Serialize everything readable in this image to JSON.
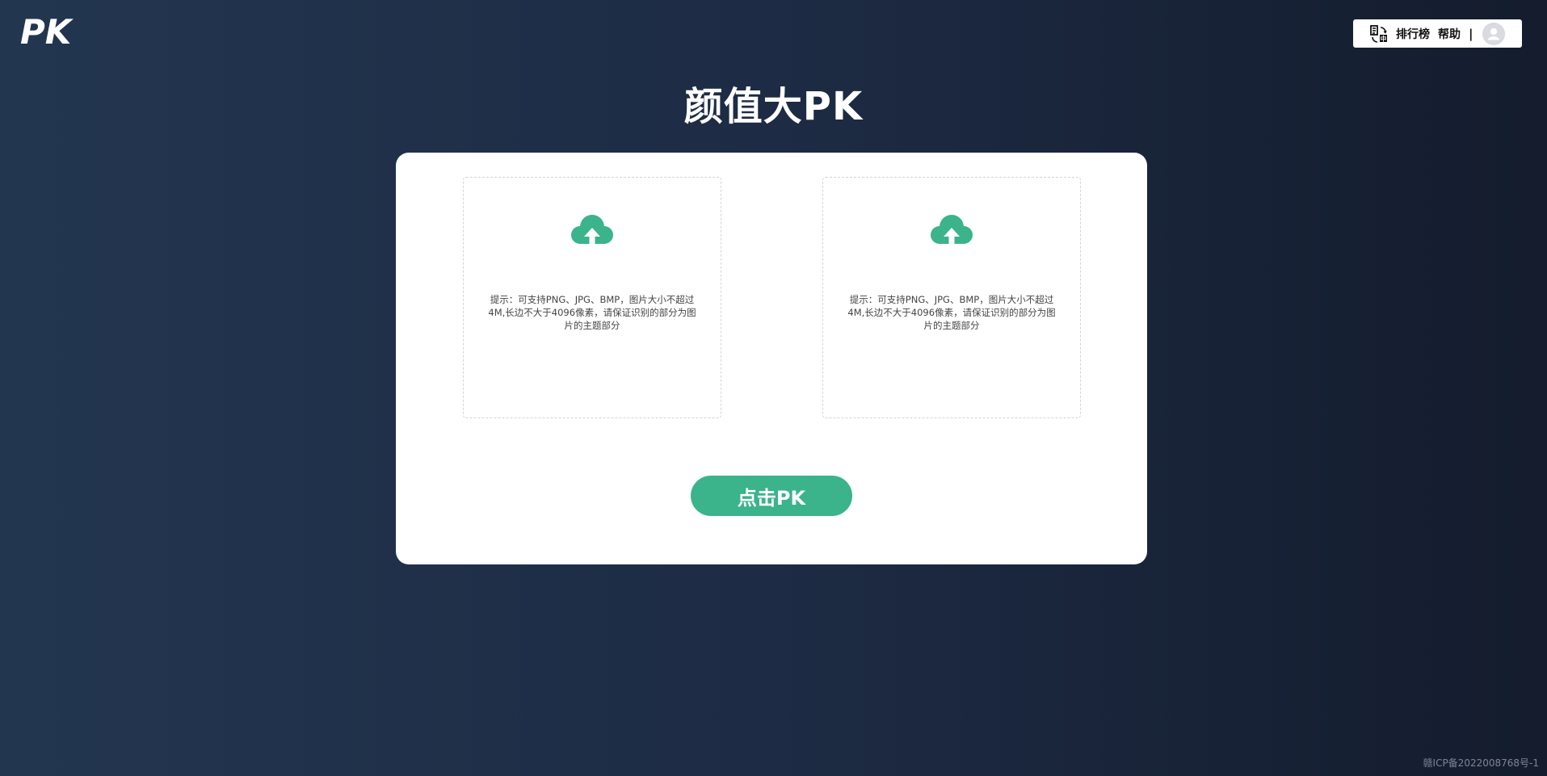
{
  "header": {
    "logo_text": "PK",
    "nav": {
      "language_icon": "translate-icon",
      "ranking_label": "排行榜",
      "help_label": "帮助",
      "separator": "|",
      "avatar_icon": "user-avatar-icon"
    }
  },
  "page": {
    "title": "颜值大PK"
  },
  "uploads": [
    {
      "icon": "cloud-upload-icon",
      "hint": "提示：可支持PNG、JPG、BMP，图片大小不超过4M,长边不大于4096像素，请保证识别的部分为图片的主题部分"
    },
    {
      "icon": "cloud-upload-icon",
      "hint": "提示：可支持PNG、JPG、BMP，图片大小不超过4M,长边不大于4096像素，请保证识别的部分为图片的主题部分"
    }
  ],
  "actions": {
    "pk_button_label": "点击PK"
  },
  "footer": {
    "icp": "赣ICP备2022008768号-1"
  },
  "colors": {
    "accent": "#3bb38b",
    "background_left": "#233650",
    "background_right": "#141c2d",
    "card": "#ffffff"
  }
}
